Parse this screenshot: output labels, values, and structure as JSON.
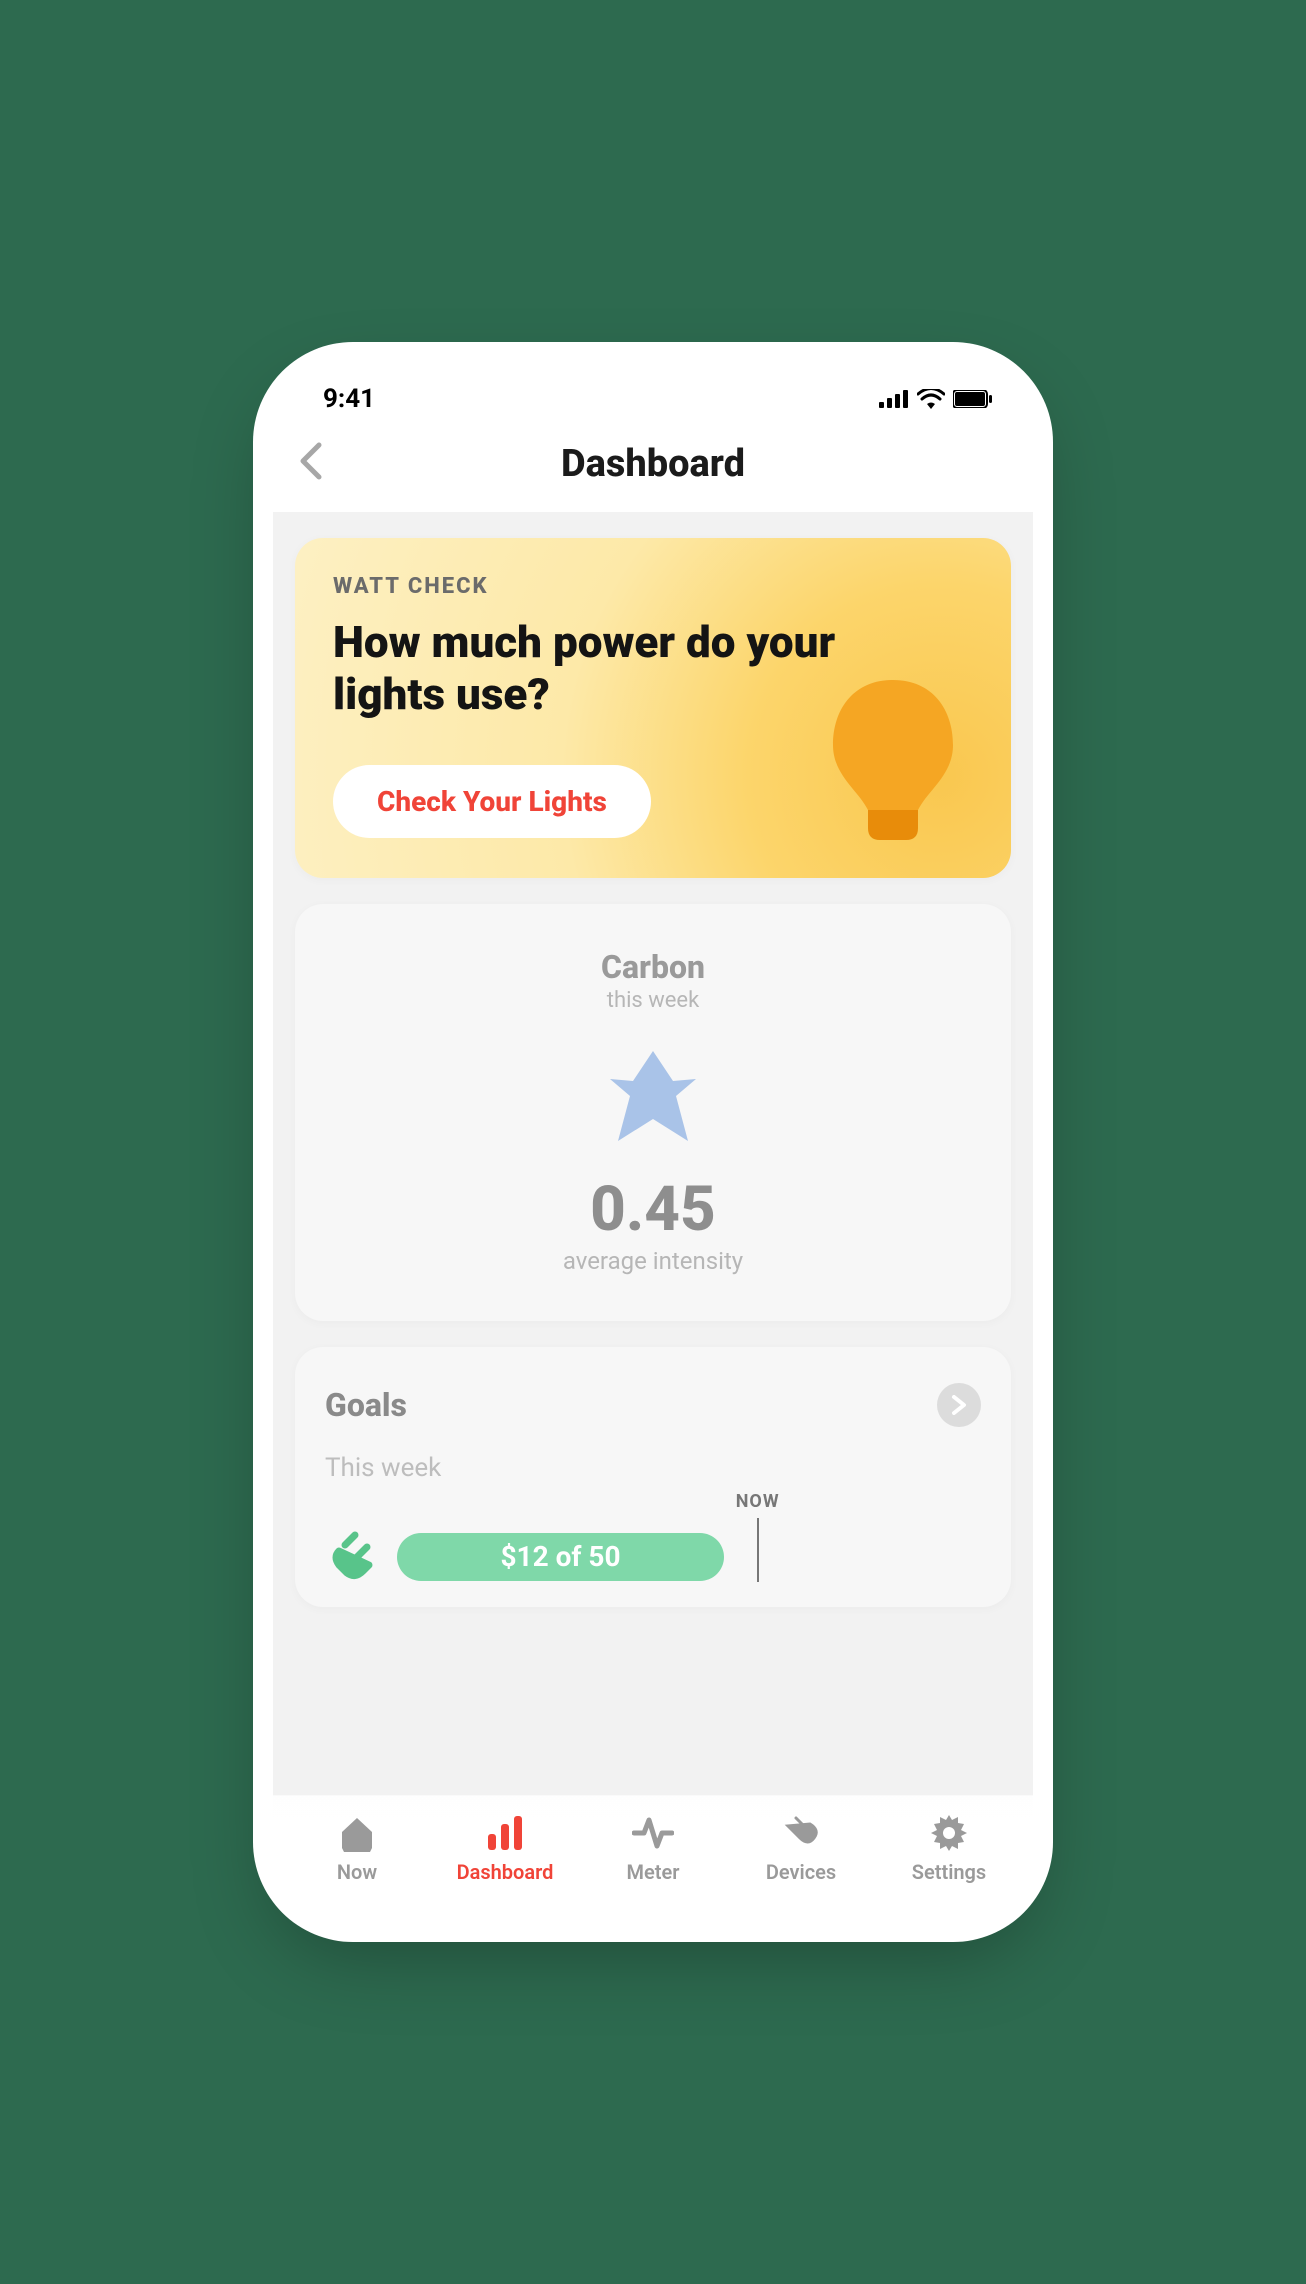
{
  "status": {
    "time": "9:41"
  },
  "nav": {
    "title": "Dashboard"
  },
  "watt": {
    "kicker": "WATT CHECK",
    "headline": "How much power do your lights use?",
    "button": "Check Your Lights"
  },
  "carbon": {
    "title": "Carbon",
    "period": "this week",
    "value": "0.45",
    "label": "average intensity"
  },
  "goals": {
    "title": "Goals",
    "period": "This week",
    "now": "NOW",
    "progress_text": "$12 of 50"
  },
  "tabs": {
    "now": "Now",
    "dashboard": "Dashboard",
    "meter": "Meter",
    "devices": "Devices",
    "settings": "Settings"
  }
}
